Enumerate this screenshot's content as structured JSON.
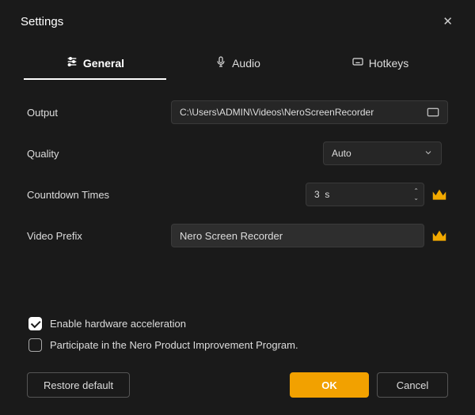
{
  "window": {
    "title": "Settings"
  },
  "tabs": {
    "general": "General",
    "audio": "Audio",
    "hotkeys": "Hotkeys",
    "active": "general"
  },
  "fields": {
    "output": {
      "label": "Output",
      "value": "C:\\Users\\ADMIN\\Videos\\NeroScreenRecorder"
    },
    "quality": {
      "label": "Quality",
      "value": "Auto"
    },
    "countdown": {
      "label": "Countdown Times",
      "value": "3",
      "unit": "s",
      "premium": true
    },
    "prefix": {
      "label": "Video Prefix",
      "value": "Nero Screen Recorder",
      "premium": true
    }
  },
  "checks": {
    "hwaccel": {
      "label": "Enable hardware acceleration",
      "checked": true
    },
    "improve": {
      "label": "Participate in the Nero Product Improvement Program.",
      "checked": false
    }
  },
  "buttons": {
    "restore": "Restore default",
    "ok": "OK",
    "cancel": "Cancel"
  }
}
